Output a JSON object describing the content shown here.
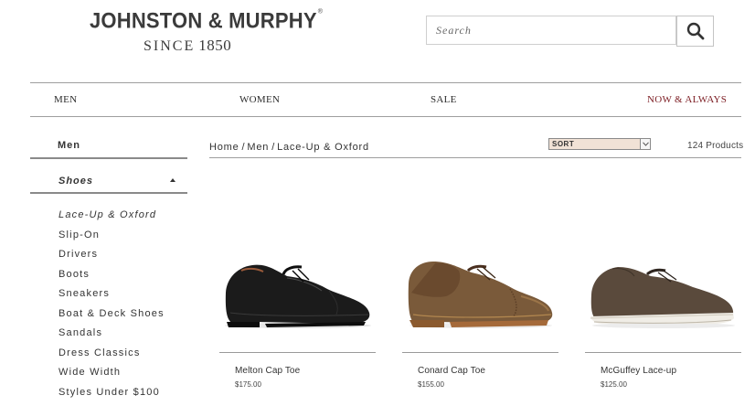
{
  "brand": {
    "name": "JOHNSTON & MURPHY",
    "since": "SINCE",
    "year": "1850"
  },
  "search": {
    "placeholder": "Search"
  },
  "nav": {
    "items": [
      "MEN",
      "WOMEN",
      "SALE",
      "NOW & ALWAYS"
    ]
  },
  "sidebar": {
    "section": "Men",
    "category": "Shoes",
    "items": [
      "Lace-Up & Oxford",
      "Slip-On",
      "Drivers",
      "Boots",
      "Sneakers",
      "Boat & Deck Shoes",
      "Sandals",
      "Dress Classics",
      "Wide Width",
      "Styles Under $100"
    ]
  },
  "breadcrumb": {
    "items": [
      "Home",
      "Men",
      "Lace-Up & Oxford"
    ],
    "separator": "/"
  },
  "sort": {
    "label": "SORT"
  },
  "product_count": "124 Products",
  "products": [
    {
      "name": "Melton Cap Toe",
      "price": "$175.00",
      "color": "#1b1b1b"
    },
    {
      "name": "Conard Cap Toe",
      "price": "$155.00",
      "color": "#7a5a3a"
    },
    {
      "name": "McGuffey Lace-up",
      "price": "$125.00",
      "color": "#5a4a3c"
    }
  ],
  "colors": {
    "accent": "#7d1e24",
    "sort_bg": "#f1e2d6"
  }
}
